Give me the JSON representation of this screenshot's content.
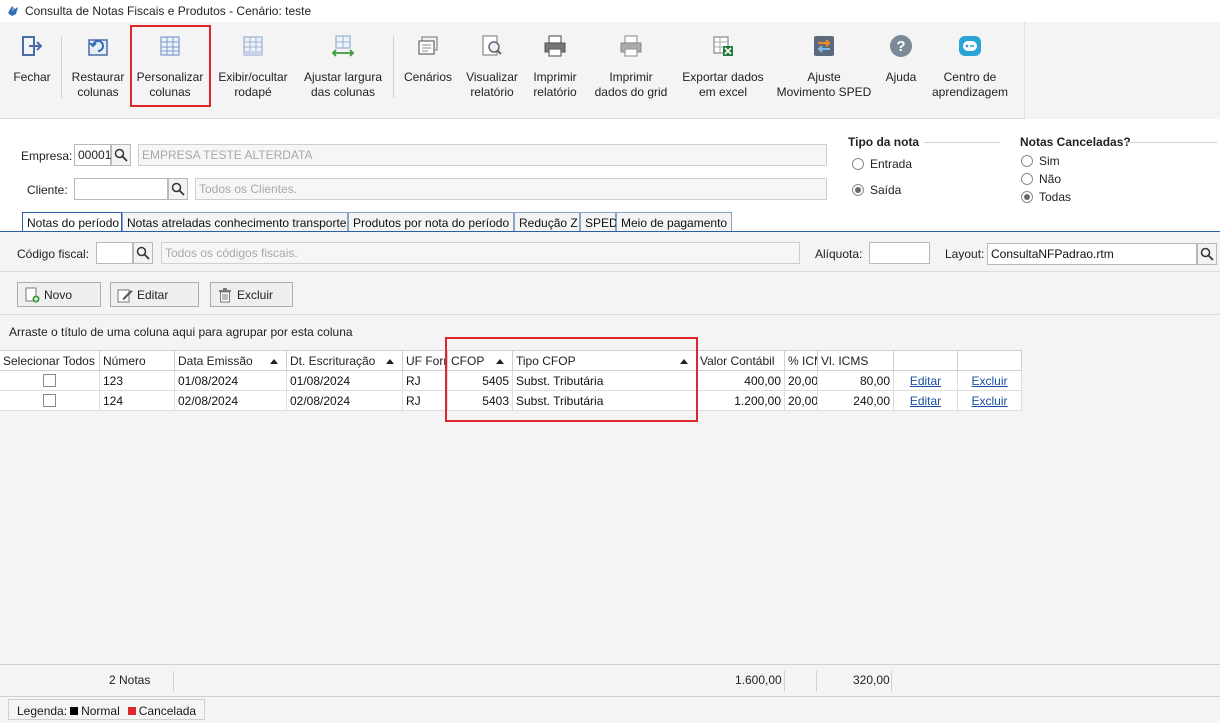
{
  "window": {
    "title": "Consulta de Notas Fiscais e Produtos - Cenário: teste"
  },
  "toolbar": {
    "fechar": "Fechar",
    "restaurar": [
      "Restaurar",
      "colunas"
    ],
    "personalizar": [
      "Personalizar",
      "colunas"
    ],
    "exibir": [
      "Exibir/ocultar",
      "rodapé"
    ],
    "ajustar": [
      "Ajustar largura",
      "das colunas"
    ],
    "cenarios": "Cenários",
    "visualizar": [
      "Visualizar",
      "relatório"
    ],
    "imprimir": [
      "Imprimir",
      "relatório"
    ],
    "imprimir_grid": [
      "Imprimir",
      "dados do grid"
    ],
    "exportar": [
      "Exportar dados",
      "em excel"
    ],
    "ajuste": [
      "Ajuste",
      "Movimento SPED"
    ],
    "ajuda": "Ajuda",
    "centro": [
      "Centro de",
      "aprendizagem"
    ]
  },
  "filters": {
    "empresa_label": "Empresa:",
    "empresa_code": "00001",
    "empresa_name": "EMPRESA TESTE ALTERDATA",
    "cliente_label": "Cliente:",
    "cliente_code": "",
    "cliente_name": "Todos os Clientes."
  },
  "tipo_nota": {
    "title": "Tipo da nota",
    "options": [
      "Entrada",
      "Saída"
    ],
    "selected": "Saída"
  },
  "notas_canceladas": {
    "title": "Notas Canceladas?",
    "options": [
      "Sim",
      "Não",
      "Todas"
    ],
    "selected": "Todas"
  },
  "tabs": [
    "Notas do período",
    "Notas atreladas conhecimento transporte",
    "Produtos por nota do período",
    "Redução Z",
    "SPED",
    "Meio de pagamento"
  ],
  "subfilters": {
    "codigo_fiscal_label": "Código fiscal:",
    "codigo_fiscal_value": "",
    "codigo_fiscal_desc": "Todos os códigos fiscais.",
    "aliquota_label": "Alíquota:",
    "aliquota_value": "",
    "layout_label": "Layout:",
    "layout_value": "ConsultaNFPadrao.rtm"
  },
  "actions": {
    "novo": "Novo",
    "editar": "Editar",
    "excluir": "Excluir"
  },
  "group_hint": "Arraste o título de uma coluna aqui para agrupar por esta coluna",
  "grid": {
    "columns": [
      "Selecionar Todos",
      "Número",
      "Data Emissão",
      "Dt. Escrituração",
      "UF Forn",
      "CFOP",
      "Tipo CFOP",
      "Valor Contábil",
      "% ICMS",
      "Vl. ICMS",
      "",
      ""
    ],
    "rows": [
      {
        "numero": "123",
        "data_emissao": "01/08/2024",
        "dt_escrituracao": "01/08/2024",
        "uf": "RJ",
        "cfop": "5405",
        "tipo_cfop": "Subst. Tributária",
        "valor_contabil": "400,00",
        "pct_icms": "20,00",
        "vl_icms": "80,00",
        "editar": "Editar",
        "excluir": "Excluir"
      },
      {
        "numero": "124",
        "data_emissao": "02/08/2024",
        "dt_escrituracao": "02/08/2024",
        "uf": "RJ",
        "cfop": "5403",
        "tipo_cfop": "Subst. Tributária",
        "valor_contabil": "1.200,00",
        "pct_icms": "20,00",
        "vl_icms": "240,00",
        "editar": "Editar",
        "excluir": "Excluir"
      }
    ]
  },
  "footer": {
    "count": "2 Notas",
    "total_valor": "1.600,00",
    "total_icms": "320,00"
  },
  "legend": {
    "label": "Legenda:",
    "normal": "Normal",
    "cancelada": "Cancelada",
    "normal_color": "#000000",
    "cancelada_color": "#e0262d"
  },
  "colors": {
    "highlight": "#e0262d",
    "link": "#1a4fa0",
    "tab_border": "#2a5fa8"
  }
}
